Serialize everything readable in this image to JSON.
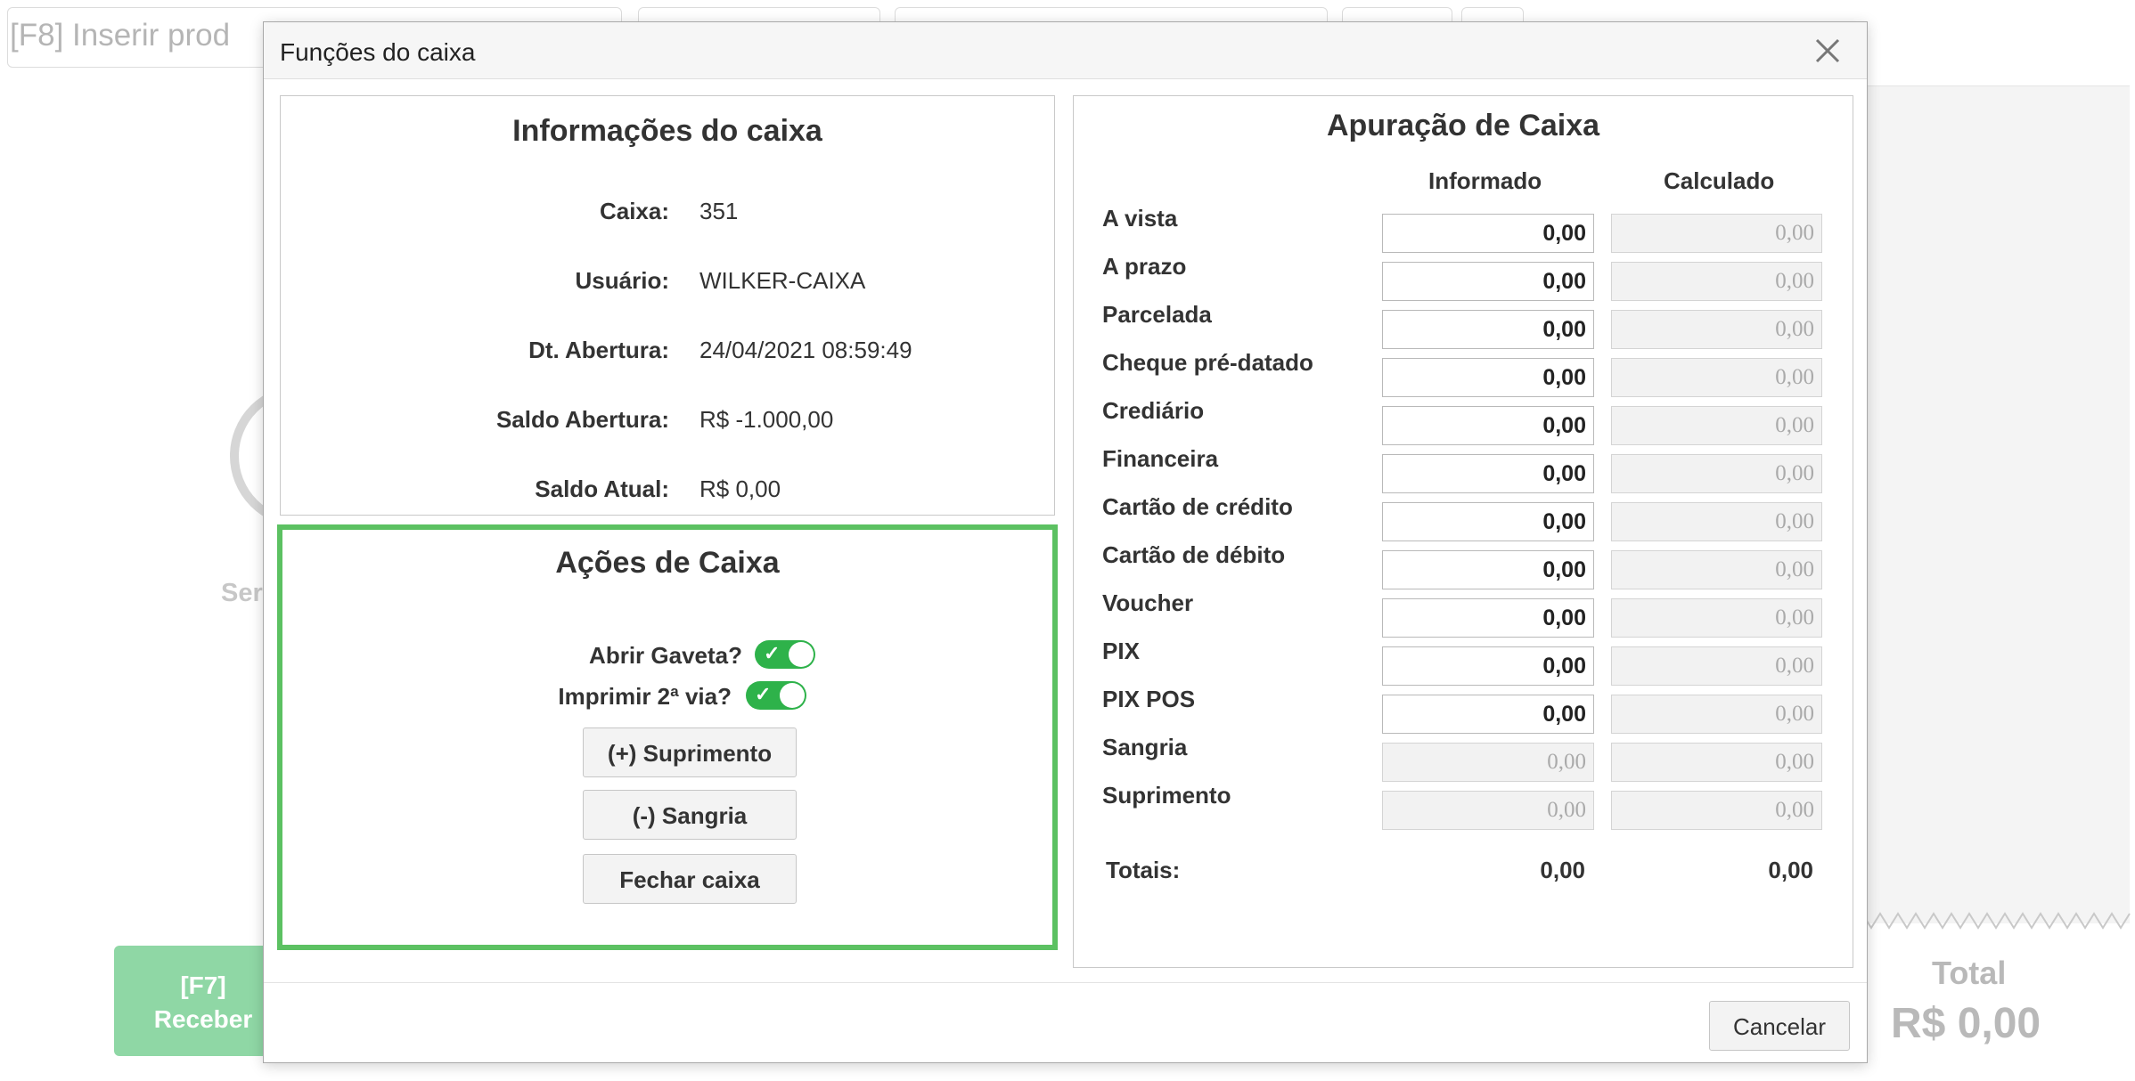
{
  "background": {
    "search_placeholder": "[F8] Inserir prod",
    "ser_text": "Ser",
    "receive_key": "[F7]",
    "receive_label": "Receber",
    "total_label": "Total",
    "total_value": "R$ 0,00"
  },
  "modal": {
    "title": "Funções do caixa",
    "info": {
      "title": "Informações do caixa",
      "rows": [
        {
          "label": "Caixa:",
          "value": "351"
        },
        {
          "label": "Usuário:",
          "value": "WILKER-CAIXA"
        },
        {
          "label": "Dt. Abertura:",
          "value": "24/04/2021 08:59:49"
        },
        {
          "label": "Saldo Abertura:",
          "value": "R$ -1.000,00"
        },
        {
          "label": "Saldo Atual:",
          "value": "R$ 0,00"
        }
      ]
    },
    "actions": {
      "title": "Ações de Caixa",
      "open_drawer_label": "Abrir Gaveta?",
      "open_drawer_on": true,
      "print_copy_label": "Imprimir 2ª via?",
      "print_copy_on": true,
      "supply_button": "(+) Suprimento",
      "withdraw_button": "(-) Sangria",
      "close_button": "Fechar caixa"
    },
    "apuracao": {
      "title": "Apuração de Caixa",
      "col_informed": "Informado",
      "col_calculated": "Calculado",
      "rows": [
        {
          "label": "A vista",
          "informed": "0,00",
          "calculated": "0,00"
        },
        {
          "label": "A prazo",
          "informed": "0,00",
          "calculated": "0,00"
        },
        {
          "label": "Parcelada",
          "informed": "0,00",
          "calculated": "0,00"
        },
        {
          "label": "Cheque pré-datado",
          "informed": "0,00",
          "calculated": "0,00"
        },
        {
          "label": "Crediário",
          "informed": "0,00",
          "calculated": "0,00"
        },
        {
          "label": "Financeira",
          "informed": "0,00",
          "calculated": "0,00"
        },
        {
          "label": "Cartão de crédito",
          "informed": "0,00",
          "calculated": "0,00"
        },
        {
          "label": "Cartão de débito",
          "informed": "0,00",
          "calculated": "0,00"
        },
        {
          "label": "Voucher",
          "informed": "0,00",
          "calculated": "0,00"
        },
        {
          "label": "PIX",
          "informed": "0,00",
          "calculated": "0,00"
        },
        {
          "label": "PIX POS",
          "informed": "0,00",
          "calculated": "0,00"
        },
        {
          "label": "Sangria",
          "informed": "0,00",
          "calculated": "0,00"
        },
        {
          "label": "Suprimento",
          "informed": "0,00",
          "calculated": "0,00"
        }
      ],
      "totals_label": "Totais:",
      "total_informed": "0,00",
      "total_calculated": "0,00"
    },
    "cancel_button": "Cancelar"
  },
  "colors": {
    "accent_green": "#5cc162",
    "toggle_green": "#2eb24a",
    "receive_button": "#8fd7a5"
  }
}
